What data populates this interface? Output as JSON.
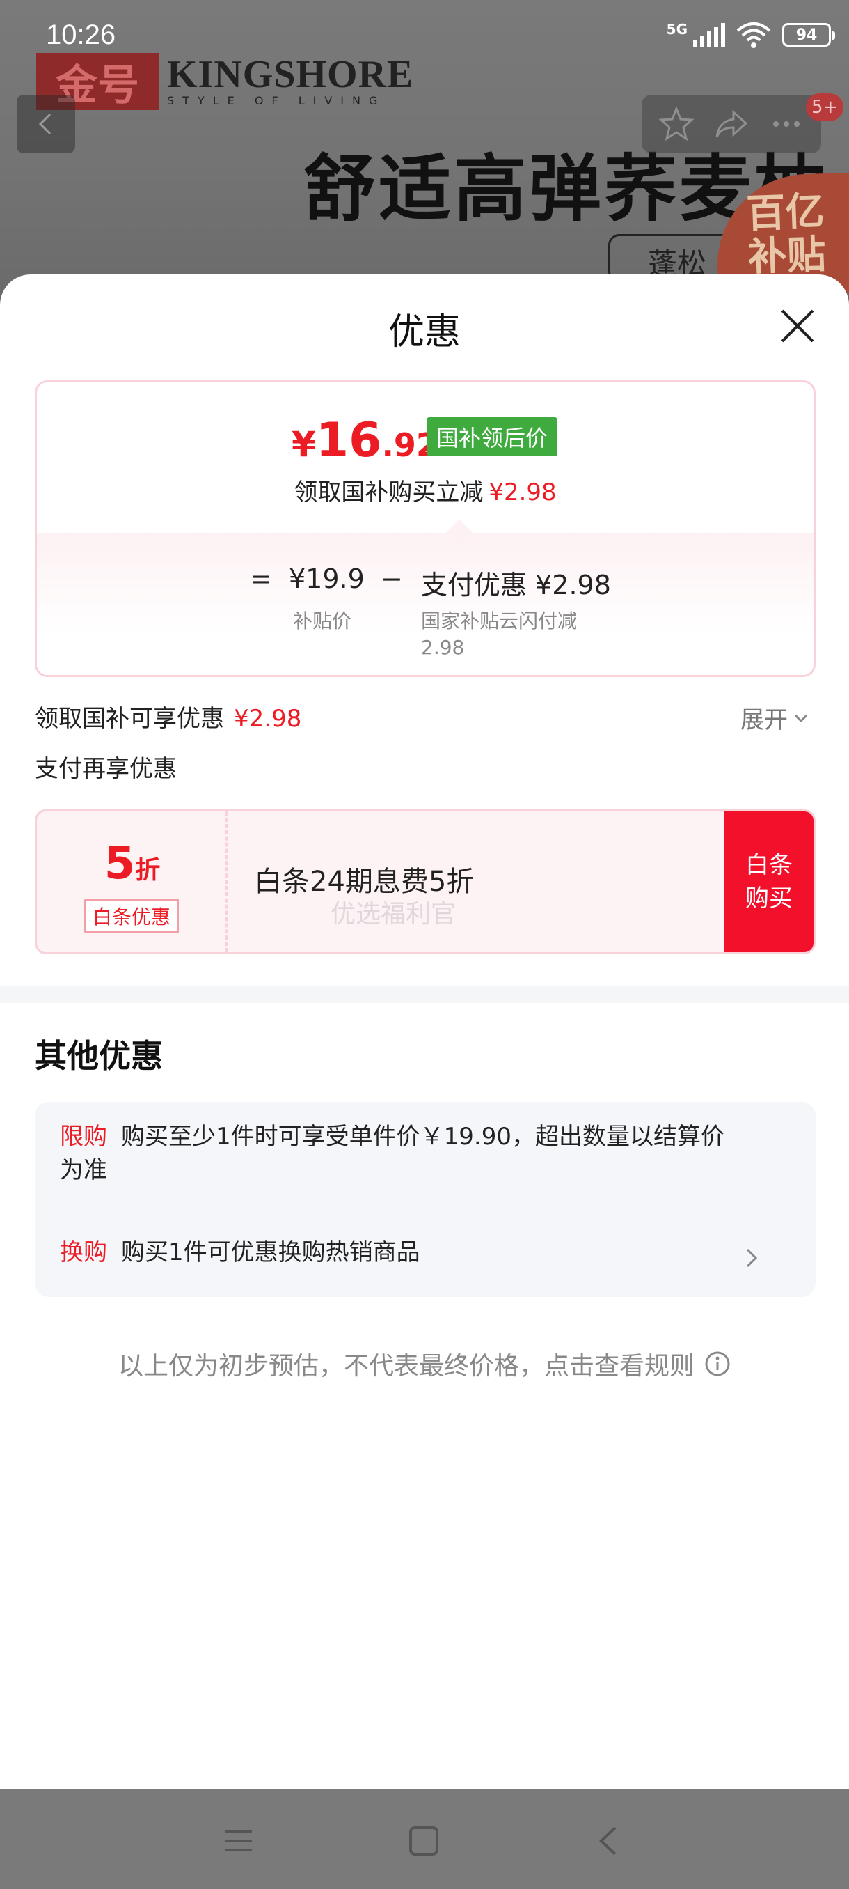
{
  "status_bar": {
    "time": "10:26",
    "network": "5G",
    "battery": "94"
  },
  "background_page": {
    "brand_cn": "金号",
    "brand_en": "KINGSHORE",
    "brand_tagline": "STYLE OF LIVING",
    "banner_title": "舒适高弹荞麦枕",
    "banner_chip": "蓬松",
    "subsidy_badge_line1": "百亿",
    "subsidy_badge_line2": "补贴",
    "cart_badge": "5+"
  },
  "sheet": {
    "title": "优惠",
    "price_card": {
      "currency": "¥",
      "price_int": "16",
      "price_dec": ".92",
      "price_tag": "国补领后价",
      "subtitle": "领取国补购买立减",
      "subtitle_amount": "¥2.98",
      "eq": "=",
      "base_price": "¥19.9",
      "base_label": "补贴价",
      "minus": "−",
      "discount_label": "支付优惠",
      "discount_amount": "¥2.98",
      "discount_desc_line1": "国家补贴云闪付减",
      "discount_desc_line2": "2.98"
    },
    "claim_row": {
      "text": "领取国补可享优惠",
      "amount": "¥2.98",
      "expand": "展开"
    },
    "pay_row": {
      "text": "支付再享优惠"
    },
    "baitiao": {
      "discount_num": "5",
      "discount_unit": "折",
      "tag": "白条优惠",
      "description": "白条24期息费5折",
      "watermark": "优选福利官",
      "buy_button": "白条购买"
    },
    "other": {
      "title": "其他优惠",
      "items": [
        {
          "tag": "限购",
          "text": "购买至少1件时可享受单件价￥19.90，超出数量以结算价",
          "text_line2": "为准"
        },
        {
          "tag": "换购",
          "text": "购买1件可优惠换购热销商品"
        }
      ]
    },
    "disclaimer": "以上仅为初步预估，不代表最终价格，点击查看规则"
  },
  "colors": {
    "accent_red": "#ec1c24",
    "tag_green": "#3fab3f",
    "buy_red": "#f3102a"
  }
}
